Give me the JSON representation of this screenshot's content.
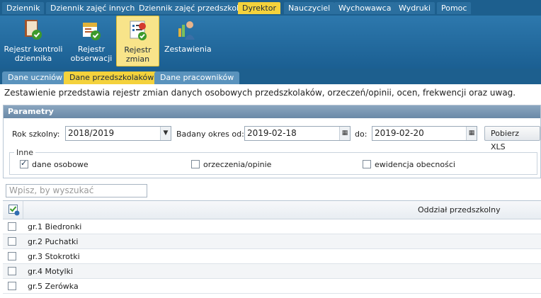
{
  "top_menu": [
    "Dziennik",
    "Dziennik zajęć innych",
    "Dziennik zajęć przedszkola",
    "Dyrektor",
    "Nauczyciel",
    "Wychowawca",
    "Wydruki",
    "Pomoc"
  ],
  "ribbon": {
    "kontrola": "Rejestr kontroli dziennika",
    "obserwacje": "Rejestr obserwacji",
    "zmiany": "Rejestr zmian",
    "zestawienia": "Zestawienia"
  },
  "subtabs": [
    "Dane uczniów",
    "Dane przedszkolaków",
    "Dane pracowników"
  ],
  "description": "Zestawienie przedstawia rejestr zmian danych osobowych przedszkolaków, orzeczeń/opinii, ocen, frekwencji oraz uwag.",
  "params": {
    "title": "Parametry",
    "rok_label": "Rok szkolny:",
    "rok_value": "2018/2019",
    "od_label": "Badany okres od:",
    "od_value": "2019-02-18",
    "do_label": "do:",
    "do_value": "2019-02-20",
    "xls_button": "Pobierz XLS",
    "inne_legend": "Inne",
    "check_dane": "dane osobowe",
    "check_orzeczenia": "orzeczenia/opinie",
    "check_ewidencja": "ewidencja obecności",
    "dane_checked": true,
    "orzeczenia_checked": false,
    "ewidencja_checked": false
  },
  "search_placeholder": "Wpisz, by wyszukać",
  "grid": {
    "column": "Oddział przedszkolny",
    "rows": [
      "gr.1 Biedronki",
      "gr.2 Puchatki",
      "gr.3 Stokrotki",
      "gr.4 Motylki",
      "gr.5 Zerówka"
    ]
  },
  "colors": {
    "menu_bg": "#1d5f8e",
    "active_tab": "#f4d23c",
    "ribbon_active": "#f8e48a"
  }
}
